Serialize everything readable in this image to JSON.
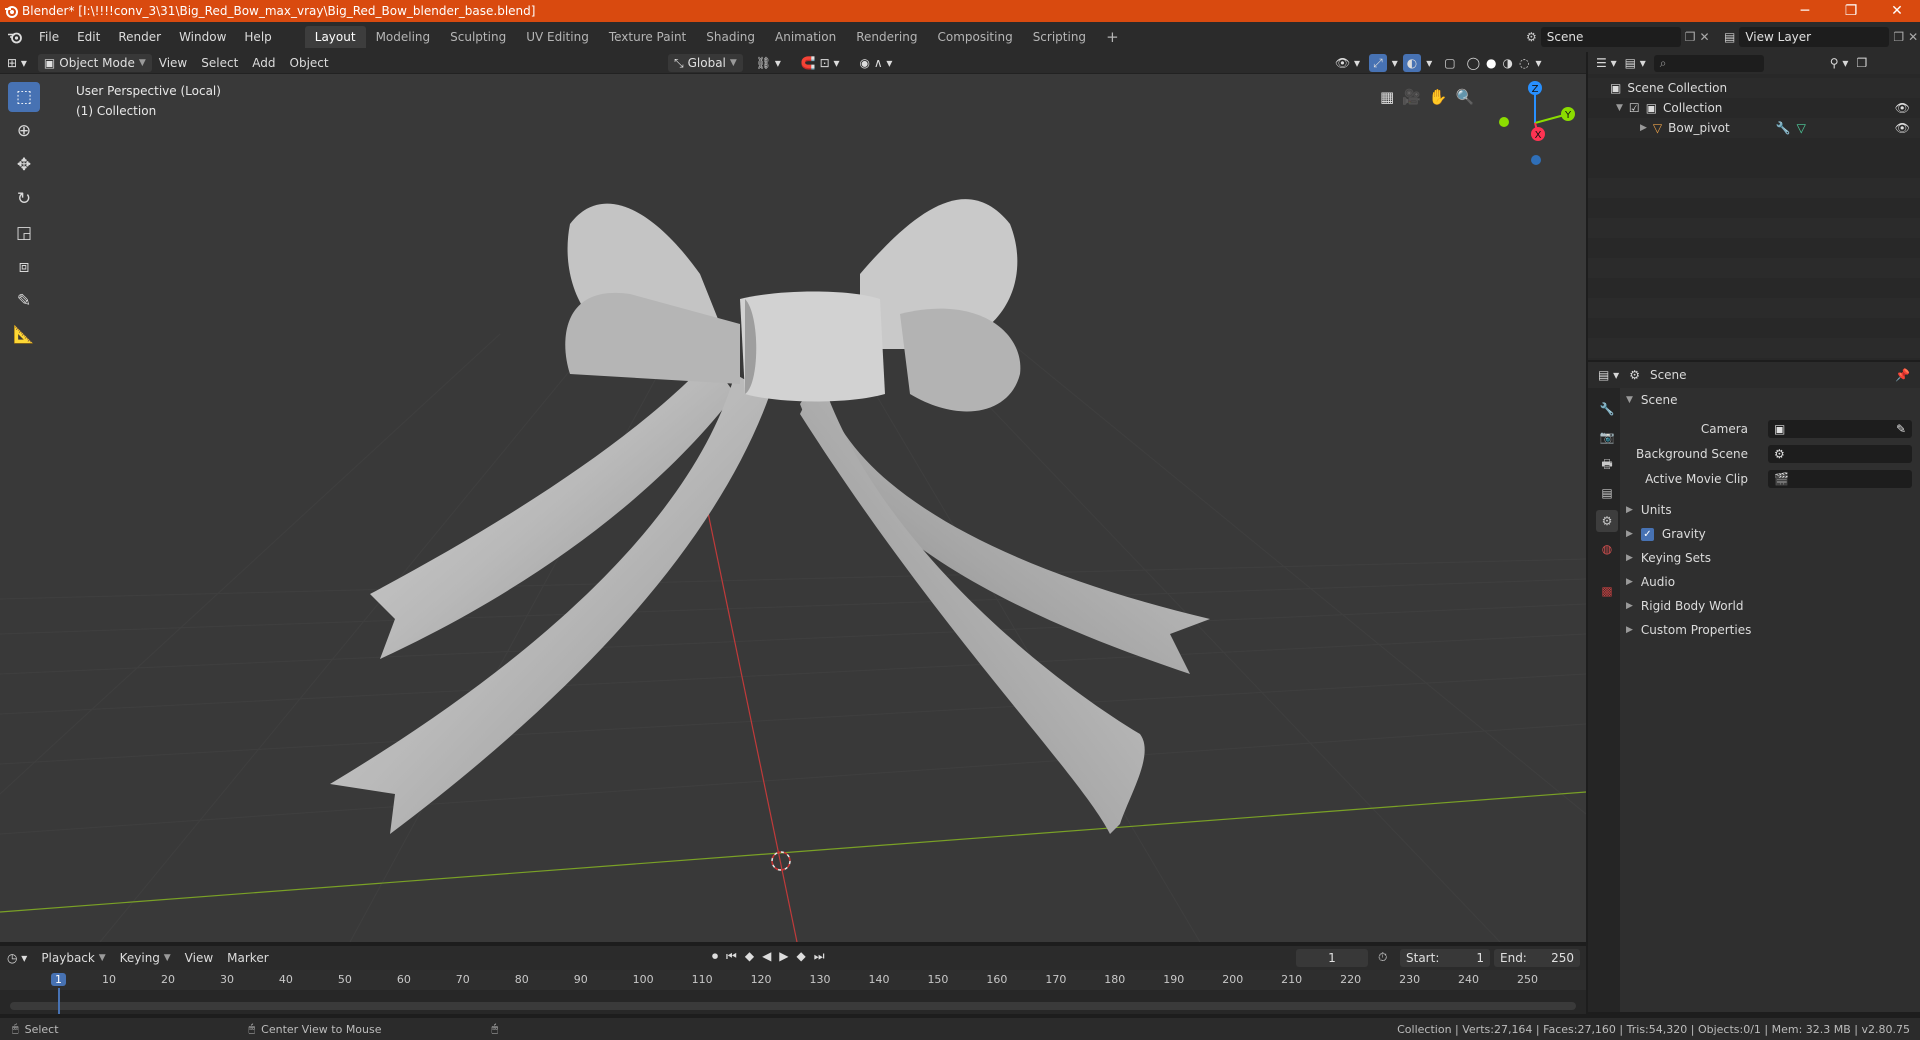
{
  "window": {
    "title": "Blender* [I:\\!!!!conv_3\\31\\Big_Red_Bow_max_vray\\Big_Red_Bow_blender_base.blend]",
    "minimize": "─",
    "maximize": "❐",
    "close": "✕"
  },
  "menu": [
    "File",
    "Edit",
    "Render",
    "Window",
    "Help"
  ],
  "workspaces": [
    "Layout",
    "Modeling",
    "Sculpting",
    "UV Editing",
    "Texture Paint",
    "Shading",
    "Animation",
    "Rendering",
    "Compositing",
    "Scripting"
  ],
  "workspace_active": "Layout",
  "workspace_add": "+",
  "scene_field": "Scene",
  "view_layer_field": "View Layer",
  "viewport": {
    "mode": "Object Mode",
    "menus": [
      "View",
      "Select",
      "Add",
      "Object"
    ],
    "orientation": "Global",
    "overlay_line1": "User Perspective (Local)",
    "overlay_line2": "(1) Collection",
    "gizmo": {
      "z": "Z",
      "y": "Y",
      "x": "X"
    }
  },
  "outliner": {
    "root": "Scene Collection",
    "collection": "Collection",
    "object": "Bow_pivot",
    "search_placeholder": ""
  },
  "properties": {
    "context": "Scene",
    "panel": "Scene",
    "camera_label": "Camera",
    "background_scene_label": "Background Scene",
    "active_clip_label": "Active Movie Clip",
    "sections": [
      "Units",
      "Gravity",
      "Keying Sets",
      "Audio",
      "Rigid Body World",
      "Custom Properties"
    ],
    "gravity_checked": true
  },
  "timeline": {
    "menus": [
      "Playback",
      "Keying",
      "View",
      "Marker"
    ],
    "current_frame": "1",
    "start_label": "Start:",
    "start": "1",
    "end_label": "End:",
    "end": "250",
    "ruler": [
      "1",
      "10",
      "20",
      "30",
      "40",
      "50",
      "60",
      "70",
      "80",
      "90",
      "100",
      "110",
      "120",
      "130",
      "140",
      "150",
      "160",
      "170",
      "180",
      "190",
      "200",
      "210",
      "220",
      "230",
      "240",
      "250"
    ]
  },
  "status": {
    "left_action": "Select",
    "mid_action": "Center View to Mouse",
    "stats": "Collection | Verts:27,164 | Faces:27,160 | Tris:54,320 | Objects:0/1 | Mem: 32.3 MB | v2.80.75"
  },
  "colors": {
    "accent": "#4772b3",
    "titlebar": "#d94a0f",
    "x_axis": "#ff3352",
    "y_axis": "#8bdc00",
    "z_axis": "#2890ff"
  }
}
